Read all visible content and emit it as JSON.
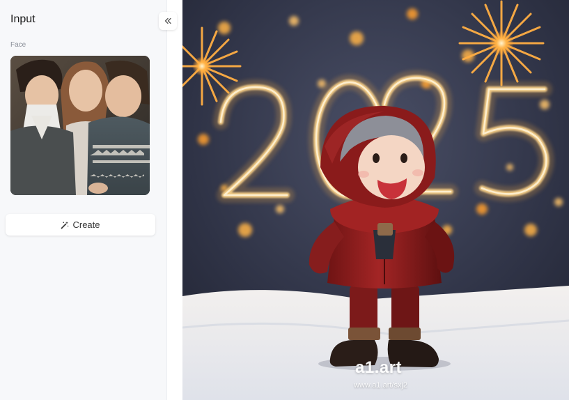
{
  "panel": {
    "title": "Input",
    "collapse_icon": "double-chevron-left-icon",
    "face_label": "Face",
    "create_label": "Create",
    "create_icon": "magic-wand-icon"
  },
  "result": {
    "watermark": "a1.art",
    "watermark_url": "www.a1.art/sxj2"
  },
  "colors": {
    "panel_bg": "#f7f8fa",
    "sky": "#2b2f3e",
    "glow": "#ffb347",
    "coat": "#8e1d1d",
    "snow": "#eef0f4"
  }
}
